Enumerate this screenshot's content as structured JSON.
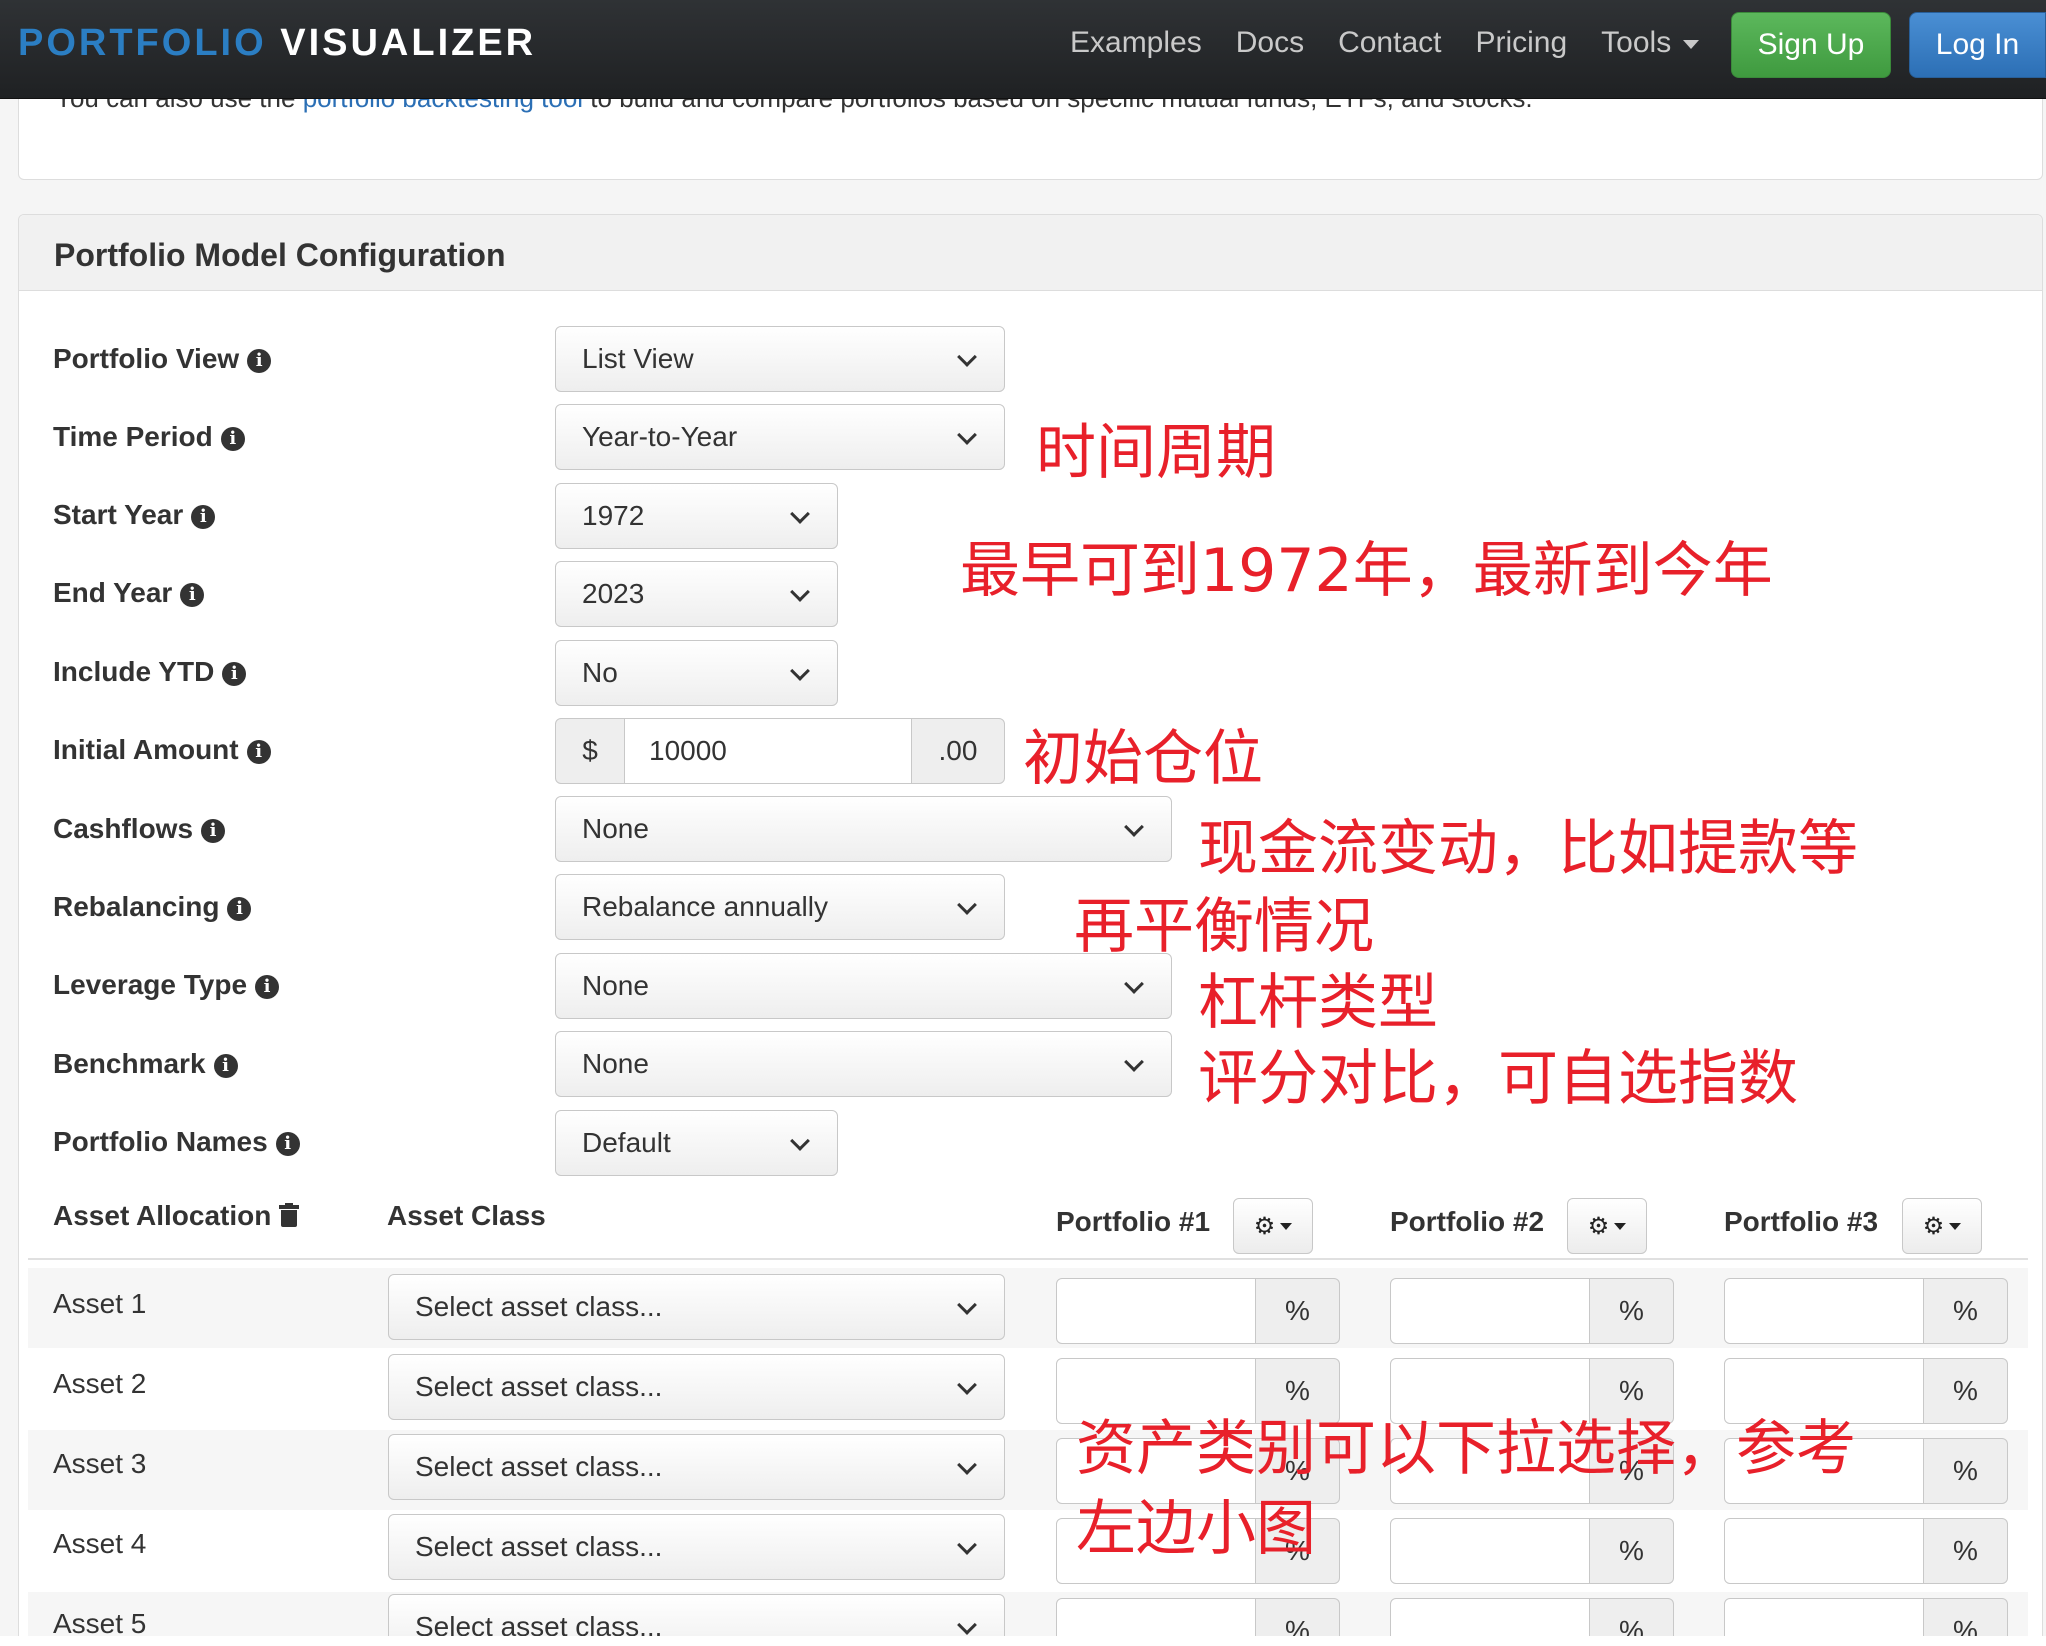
{
  "nav": {
    "brand_part1": "PORTFOLIO",
    "brand_part2": "VISUALIZER",
    "links": [
      "Examples",
      "Docs",
      "Contact",
      "Pricing",
      "Tools"
    ],
    "signup": "Sign Up",
    "login": "Log In"
  },
  "intro": {
    "text_before": "You can also use the ",
    "link": "portfolio backtesting tool",
    "text_after": " to build and compare portfolios based on specific mutual funds, ETFs, and stocks."
  },
  "config": {
    "title": "Portfolio Model Configuration",
    "fields": {
      "portfolio_view": {
        "label": "Portfolio View",
        "value": "List View"
      },
      "time_period": {
        "label": "Time Period",
        "value": "Year-to-Year"
      },
      "start_year": {
        "label": "Start Year",
        "value": "1972"
      },
      "end_year": {
        "label": "End Year",
        "value": "2023"
      },
      "include_ytd": {
        "label": "Include YTD",
        "value": "No"
      },
      "initial_amount": {
        "label": "Initial Amount",
        "prefix": "$",
        "value": "10000",
        "suffix": ".00"
      },
      "cashflows": {
        "label": "Cashflows",
        "value": "None"
      },
      "rebalancing": {
        "label": "Rebalancing",
        "value": "Rebalance annually"
      },
      "leverage_type": {
        "label": "Leverage Type",
        "value": "None"
      },
      "benchmark": {
        "label": "Benchmark",
        "value": "None"
      },
      "portfolio_names": {
        "label": "Portfolio Names",
        "value": "Default"
      }
    }
  },
  "assets": {
    "allocation_label": "Asset Allocation",
    "class_label": "Asset Class",
    "portfolios": [
      "Portfolio #1",
      "Portfolio #2",
      "Portfolio #3"
    ],
    "placeholder": "Select asset class...",
    "percent_symbol": "%",
    "rows": [
      "Asset 1",
      "Asset 2",
      "Asset 3",
      "Asset 4",
      "Asset 5"
    ]
  },
  "annotations": {
    "time_period": "时间周期",
    "years": "最早可到1972年，最新到今年",
    "initial": "初始仓位",
    "cashflow": "现金流变动，比如提款等",
    "rebalance": "再平衡情况",
    "leverage": "杠杆类型",
    "benchmark": "评分对比，可自选指数",
    "asset_line1": "资产类别可以下拉选择，参考",
    "asset_line2": "左边小图"
  },
  "colors": {
    "brand_blue": "#2b7ec3",
    "signup_green": "#5cb85c",
    "login_blue": "#3a7fc8",
    "annotation_red": "#e8202a"
  }
}
